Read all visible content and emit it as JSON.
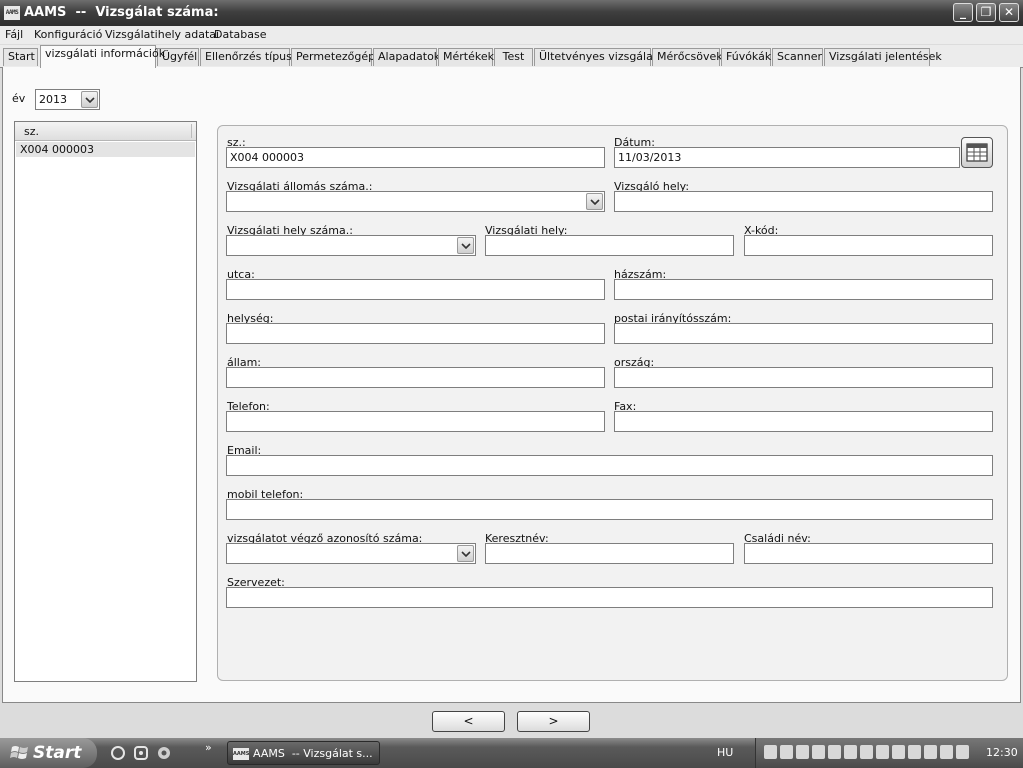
{
  "window": {
    "icon_text": "AAMS",
    "title": "AAMS  --  Vizsgálat száma:",
    "minimize": "_",
    "restore": "❐",
    "close": "✕"
  },
  "menu": [
    "Fájl",
    "Konfiguráció",
    "Vizsgálatihely adatai",
    "Database"
  ],
  "tabs": [
    "Start",
    "vizsgálati információk",
    "Ügyfél",
    "Ellenőrzés típusa",
    "Permetezőgép",
    "Alapadatok",
    "Mértékek",
    "Test",
    "Ültetvényes vizsgálat",
    "Mérőcsövek",
    "Fúvókák",
    "Scanner",
    "Vizsgálati jelentések"
  ],
  "active_tab": "vizsgálati információk",
  "year": {
    "label": "év",
    "value": "2013"
  },
  "list": {
    "header": "sz.",
    "rows": [
      "X004 000003"
    ]
  },
  "form": {
    "sz_label": "sz.:",
    "sz_value": "X004 000003",
    "datum_label": "Dátum:",
    "datum_value": "11/03/2013",
    "allomas_label": "Vizsgálati állomás száma.:",
    "vizsgalo_hely_label": "Vizsgáló hely:",
    "hely_szama_label": "Vizsgálati hely száma.:",
    "vizsgalati_hely_label": "Vizsgálati hely:",
    "xkod_label": "X-kód:",
    "utca_label": "utca:",
    "hazszam_label": "házszám:",
    "helyseg_label": "helység:",
    "iranyitoszam_label": "postai irányítósszám:",
    "allam_label": "állam:",
    "orszag_label": "ország:",
    "telefon_label": "Telefon:",
    "fax_label": "Fax:",
    "email_label": "Email:",
    "mobil_label": "mobil telefon:",
    "azonosito_label": "vizsgálatot végző azonosító száma:",
    "keresztnev_label": "Keresztnév:",
    "csaladi_label": "Családi név:",
    "szervezet_label": "Szervezet:"
  },
  "nav": {
    "prev": "<",
    "next": ">"
  },
  "taskbar": {
    "start": "Start",
    "task_icon_text": "AAMS",
    "task": "AAMS  -- Vizsgálat s...",
    "chevron": "»",
    "lang": "HU",
    "clock": "12:30"
  },
  "icons": [
    "app-icon",
    "calendar-icon",
    "windows-flag-icon",
    "browser-icon",
    "media-icon",
    "refresh-icon"
  ]
}
